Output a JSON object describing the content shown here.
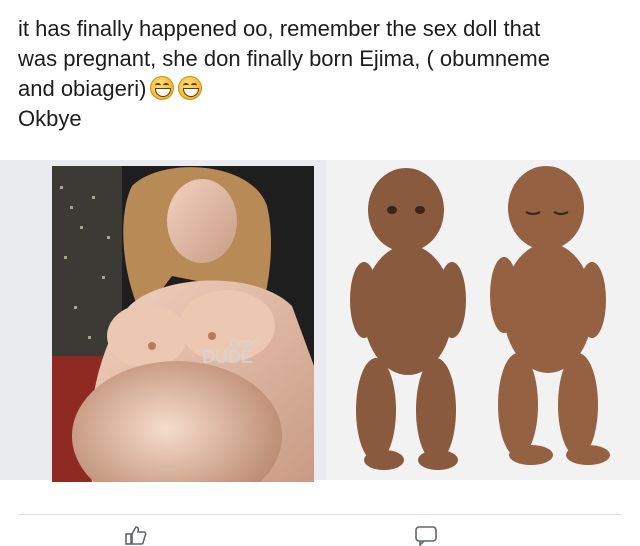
{
  "post": {
    "text_line1": "it has finally happened oo, remember the sex doll that",
    "text_line2": "was pregnant, she don finally born Ejima, ( obumneme",
    "text_line3": "and obiageri)",
    "text_line4": "Okbye",
    "emojis": [
      "grinning-squinting-face",
      "grinning-squinting-face"
    ]
  },
  "photos": {
    "left": {
      "watermark_top": "Dope",
      "watermark_bottom": "DUDE"
    },
    "right": {}
  },
  "actions": [
    "like-icon",
    "comment-icon"
  ]
}
